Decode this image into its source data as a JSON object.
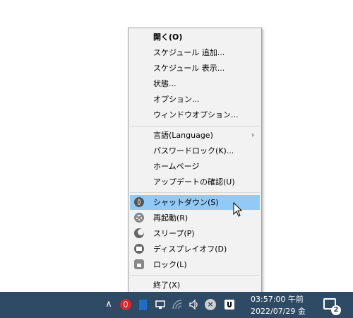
{
  "menu": {
    "items": [
      {
        "label": "開く(O)",
        "bold": true
      },
      {
        "label": "スケジュール 追加..."
      },
      {
        "label": "スケジュール 表示..."
      },
      {
        "label": "状態..."
      },
      {
        "label": "オプション..."
      },
      {
        "label": "ウィンドウオプション..."
      },
      {
        "label": "言語(Language)",
        "submenu_arrow": "›"
      },
      {
        "label": "パスワードロック(K)..."
      },
      {
        "label": "ホームページ"
      },
      {
        "label": "アップデートの確認(U)"
      },
      {
        "label": "シャットダウン(S)",
        "icon": "power-icon",
        "highlighted": true
      },
      {
        "label": "再起動(R)",
        "icon": "restart-icon"
      },
      {
        "label": "スリープ(P)",
        "icon": "sleep-moon-icon"
      },
      {
        "label": "ディスプレイオフ(D)",
        "icon": "display-icon"
      },
      {
        "label": "ロック(L)",
        "icon": "lock-icon"
      },
      {
        "label": "終了(X)"
      }
    ],
    "highlight_color": "#91c9f7"
  },
  "taskbar": {
    "background": "#2e4a64",
    "tray_icons": [
      "chevron-up-icon",
      "app-power-icon",
      "blue-app-icon",
      "network-icon",
      "wifi-icon",
      "speaker-icon",
      "close-circle-icon",
      "app-white-icon"
    ],
    "chevron": "∧",
    "close_glyph": "×",
    "speaker_glyph": "🕪",
    "clock": {
      "time": "03:57:00 午前",
      "date": "2022/07/29 金"
    },
    "notification_count": "2"
  }
}
